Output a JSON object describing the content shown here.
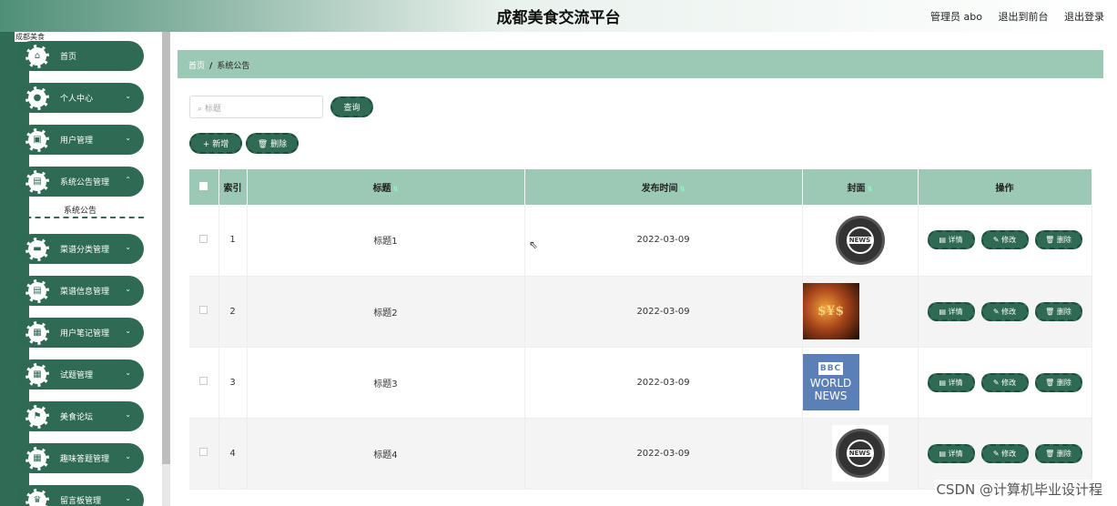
{
  "header": {
    "title": "成都美食交流平台",
    "user": "管理员 abo",
    "front_link": "退出到前台",
    "logout_link": "退出登录"
  },
  "sidebar": {
    "tiny_label": "成都美食",
    "items": [
      {
        "label": "首页",
        "icon": "home-icon",
        "has_chevron": false
      },
      {
        "label": "个人中心",
        "icon": "user-icon",
        "has_chevron": true
      },
      {
        "label": "用户管理",
        "icon": "clipboard-icon",
        "has_chevron": true
      },
      {
        "label": "系统公告管理",
        "icon": "list-icon",
        "has_chevron": true
      },
      {
        "label": "菜谱分类管理",
        "icon": "bag-icon",
        "has_chevron": true
      },
      {
        "label": "菜谱信息管理",
        "icon": "list-icon",
        "has_chevron": true
      },
      {
        "label": "用户笔记管理",
        "icon": "grid-icon",
        "has_chevron": true
      },
      {
        "label": "试题管理",
        "icon": "grid-icon",
        "has_chevron": true
      },
      {
        "label": "美食论坛",
        "icon": "flag-icon",
        "has_chevron": true
      },
      {
        "label": "趣味答题管理",
        "icon": "grid-icon",
        "has_chevron": true
      },
      {
        "label": "留言板管理",
        "icon": "trophy-icon",
        "has_chevron": true
      }
    ],
    "submenu": "系统公告"
  },
  "breadcrumb": {
    "home": "首页",
    "separator": "/",
    "current": "系统公告"
  },
  "search": {
    "placeholder": "标题",
    "button": "查询"
  },
  "actions": {
    "add": "+ 新增",
    "delete": "🗑 删除"
  },
  "table": {
    "headers": {
      "index": "索引",
      "title": "标题",
      "time": "发布时间",
      "cover": "封面",
      "ops": "操作"
    },
    "rows": [
      {
        "index": "1",
        "title": "标题1",
        "time": "2022-03-09",
        "cover": "news-globe"
      },
      {
        "index": "2",
        "title": "标题2",
        "time": "2022-03-09",
        "cover": "money"
      },
      {
        "index": "3",
        "title": "标题3",
        "time": "2022-03-09",
        "cover": "bbc-world-news"
      },
      {
        "index": "4",
        "title": "标题4",
        "time": "2022-03-09",
        "cover": "news-globe"
      }
    ],
    "ops": {
      "detail": "详情",
      "edit": "修改",
      "delete": "删除"
    },
    "cover_text": {
      "news": "NEWS",
      "bbc": "BBC",
      "world": "WORLD",
      "news2": "NEWS"
    }
  },
  "watermark": "CSDN @计算机毕业设计程"
}
